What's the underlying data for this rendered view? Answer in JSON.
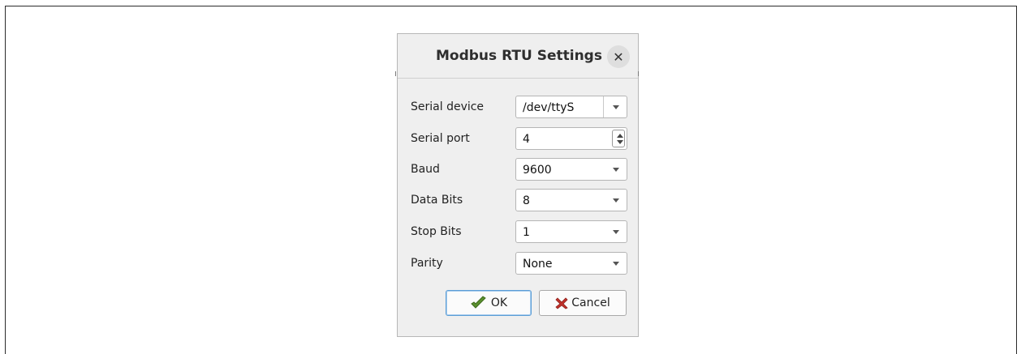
{
  "dialog": {
    "title": "Modbus RTU Settings",
    "close_icon": "close-icon"
  },
  "fields": [
    {
      "label": "Serial device",
      "value": "/dev/ttyS",
      "kind": "editable-combo"
    },
    {
      "label": "Serial port",
      "value": "4",
      "kind": "spinbox"
    },
    {
      "label": "Baud",
      "value": "9600",
      "kind": "combo"
    },
    {
      "label": "Data Bits",
      "value": "8",
      "kind": "combo"
    },
    {
      "label": "Stop Bits",
      "value": "1",
      "kind": "combo"
    },
    {
      "label": "Parity",
      "value": "None",
      "kind": "combo"
    }
  ],
  "buttons": {
    "ok_label": "OK",
    "ok_icon": "ok-check-icon",
    "cancel_label": "Cancel",
    "cancel_icon": "cancel-x-icon"
  },
  "colors": {
    "ok_icon": "#5a8f2e",
    "cancel_icon": "#c0312b",
    "focus_border": "#5b9dd6"
  }
}
